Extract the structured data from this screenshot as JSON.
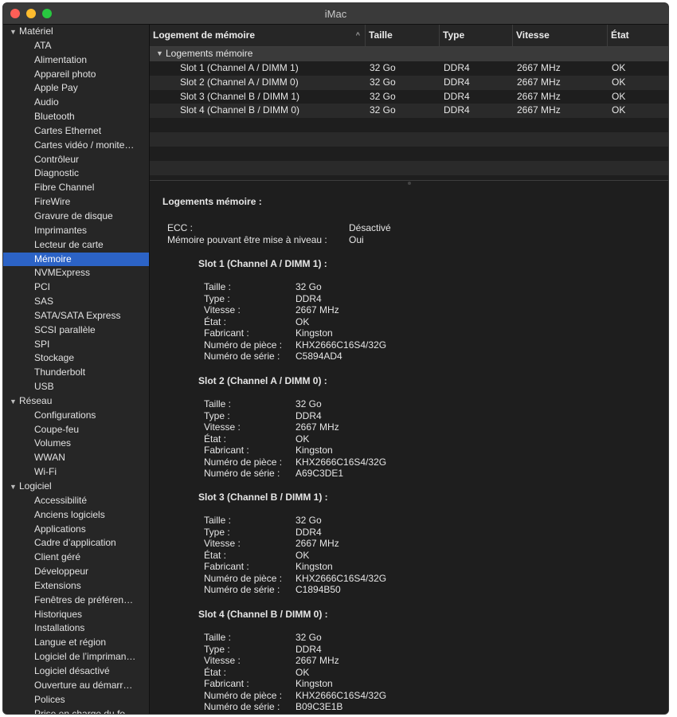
{
  "window": {
    "title": "iMac"
  },
  "sidebar": {
    "groups": [
      {
        "label": "Matériel",
        "items": [
          "ATA",
          "Alimentation",
          "Appareil photo",
          "Apple Pay",
          "Audio",
          "Bluetooth",
          "Cartes Ethernet",
          "Cartes vidéo / monite…",
          "Contrôleur",
          "Diagnostic",
          "Fibre Channel",
          "FireWire",
          "Gravure de disque",
          "Imprimantes",
          "Lecteur de carte",
          "Mémoire",
          "NVMExpress",
          "PCI",
          "SAS",
          "SATA/SATA Express",
          "SCSI parallèle",
          "SPI",
          "Stockage",
          "Thunderbolt",
          "USB"
        ]
      },
      {
        "label": "Réseau",
        "items": [
          "Configurations",
          "Coupe-feu",
          "Volumes",
          "WWAN",
          "Wi-Fi"
        ]
      },
      {
        "label": "Logiciel",
        "items": [
          "Accessibilité",
          "Anciens logiciels",
          "Applications",
          "Cadre d’application",
          "Client géré",
          "Développeur",
          "Extensions",
          "Fenêtres de préféren…",
          "Historiques",
          "Installations",
          "Langue et région",
          "Logiciel de l’impriman…",
          "Logiciel désactivé",
          "Ouverture au démarr…",
          "Polices",
          "Prise en charge du fo…"
        ]
      }
    ],
    "selected": "Mémoire"
  },
  "table": {
    "headers": [
      "Logement de mémoire",
      "Taille",
      "Type",
      "Vitesse",
      "État"
    ],
    "group_label": "Logements mémoire",
    "rows": [
      [
        "Slot 1 (Channel A / DIMM 1)",
        "32 Go",
        "DDR4",
        "2667 MHz",
        "OK"
      ],
      [
        "Slot 2 (Channel A / DIMM 0)",
        "32 Go",
        "DDR4",
        "2667 MHz",
        "OK"
      ],
      [
        "Slot 3 (Channel B / DIMM 1)",
        "32 Go",
        "DDR4",
        "2667 MHz",
        "OK"
      ],
      [
        "Slot 4 (Channel B / DIMM 0)",
        "32 Go",
        "DDR4",
        "2667 MHz",
        "OK"
      ]
    ]
  },
  "detail": {
    "title": "Logements mémoire :",
    "summary": [
      {
        "label": "ECC :",
        "value": "Désactivé"
      },
      {
        "label": "Mémoire pouvant être mise à niveau :",
        "value": "Oui"
      }
    ],
    "field_labels": [
      "Taille :",
      "Type :",
      "Vitesse :",
      "État :",
      "Fabricant :",
      "Numéro de pièce :",
      "Numéro de série :"
    ],
    "slots": [
      {
        "title": "Slot 1 (Channel A / DIMM 1) :",
        "values": [
          "32 Go",
          "DDR4",
          "2667 MHz",
          "OK",
          "Kingston",
          "KHX2666C16S4/32G",
          "C5894AD4"
        ]
      },
      {
        "title": "Slot 2 (Channel A / DIMM 0) :",
        "values": [
          "32 Go",
          "DDR4",
          "2667 MHz",
          "OK",
          "Kingston",
          "KHX2666C16S4/32G",
          "A69C3DE1"
        ]
      },
      {
        "title": "Slot 3 (Channel B / DIMM 1) :",
        "values": [
          "32 Go",
          "DDR4",
          "2667 MHz",
          "OK",
          "Kingston",
          "KHX2666C16S4/32G",
          "C1894B50"
        ]
      },
      {
        "title": "Slot 4 (Channel B / DIMM 0) :",
        "values": [
          "32 Go",
          "DDR4",
          "2667 MHz",
          "OK",
          "Kingston",
          "KHX2666C16S4/32G",
          "B09C3E1B"
        ]
      }
    ]
  },
  "icons": {
    "group_open": "▼",
    "sort_ascending": "^"
  },
  "colors": {
    "selection": "#2c63c6",
    "close": "#fe5f57",
    "minimize": "#febc2e",
    "maximize": "#28c840"
  }
}
